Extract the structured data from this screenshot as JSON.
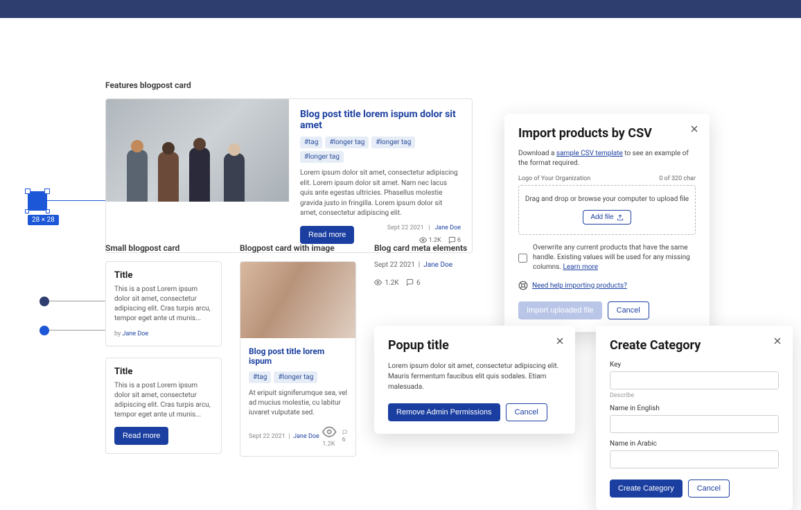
{
  "selection_badge": "28 × 28",
  "featured": {
    "section": "Features blogpost card",
    "title": "Blog post title lorem ispum dolor sit amet",
    "tags": [
      "#tag",
      "#longer tag",
      "#longer tag",
      "#longer tag"
    ],
    "text": "Lorem ipsum dolor sit amet, consectetur adipiscing elit. Lorem ipsum dolor sit amet. Nam nec lacus quis ante egestas ultricies. Phasellus molestie gravida justo in fringilla. Lorem ipsum dolor sit amet, consectetur adipiscing elit.",
    "btn": "Read more",
    "date": "Sept 22 2021",
    "author": "Jane Doe",
    "views": "1.2K",
    "comments": "6"
  },
  "small": {
    "section": "Small blogpost card",
    "card1": {
      "title": "Title",
      "text": "This is a post Lorem ipsum dolor sit amet, consectetur adipiscing elit. Cras turpis arcu, tempor eget ante ut munis...",
      "by": "by ",
      "author": "Jane Doe"
    },
    "card2": {
      "title": "Title",
      "text": "This is a post Lorem ipsum dolor sit amet, consectetur adipiscing elit. Cras turpis arcu, tempor eget ante ut munis...",
      "btn": "Read more"
    }
  },
  "imgcard": {
    "section": "Blogpost card with image",
    "title": "Blog post title lorem ispum",
    "tags": [
      "#tag",
      "#longer tag"
    ],
    "text": "At eripuit signiferumque sea, vel ad mucius molestie, cu labitur iuvaret vulputate sed.",
    "date": "Sept 22 2021",
    "author": "Jane Doe",
    "views": "1.2K",
    "comments": "6"
  },
  "metacol": {
    "section": "Blog card meta elements",
    "date": "Sept 22 2021",
    "author": "Jane Doe",
    "views": "1.2K",
    "comments": "6"
  },
  "import": {
    "title": "Import products by CSV",
    "pre": "Download a ",
    "link": "sample CSV template",
    "post": " to see an example of the format required.",
    "label": "Logo of Your Organization",
    "counter": "0 of 320 char",
    "dz": "Drag and drop or browse your computer to upload file",
    "addfile": "Add file",
    "overwrite": "Overwrite any current products that have the same handle. Existing values will be used for any missing columns. ",
    "learn": "Learn more",
    "help": "Need help importing products?",
    "primary": "Import uploaded file",
    "cancel": "Cancel"
  },
  "popup": {
    "title": "Popup title",
    "text": "Lorem ipsum dolor sit amet, consectetur adipiscing elit. Mauris fermentum faucibus elit quis sodales. Etiam malesuada.",
    "primary": "Remove Admin Permissions",
    "cancel": "Cancel"
  },
  "cat": {
    "title": "Create Category",
    "key": "Key",
    "hint": "Describe",
    "en": "Name in English",
    "ar": "Name in Arabic",
    "primary": "Create Category",
    "cancel": "Cancel"
  }
}
